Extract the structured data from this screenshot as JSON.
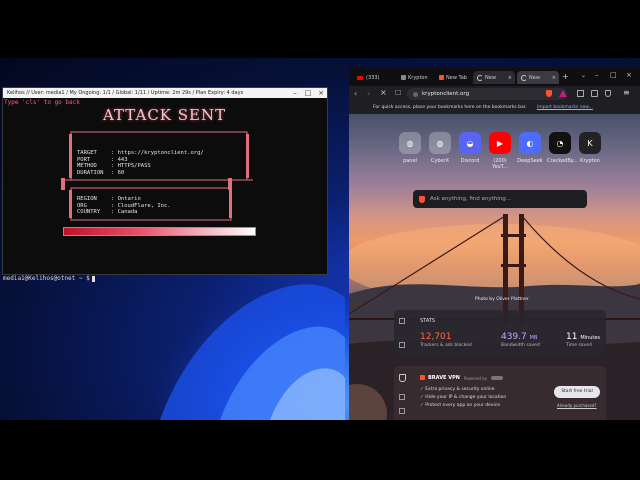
{
  "terminal": {
    "title": "Kelihos // User: media1 / My Ongoing: 1/1 / Global: 1/11 / Uptime: 2m 29s / Plan Expiry: 4 days",
    "hint": "Type 'cls' to go back",
    "banner": "ATTACK SENT",
    "fields": [
      {
        "key": "TARGET",
        "value": ": https://kryptonclient.org/"
      },
      {
        "key": "PORT",
        "value": ": 443"
      },
      {
        "key": "METHOD",
        "value": ": HTTPS/PASS"
      },
      {
        "key": "DURATION",
        "value": ": 60"
      }
    ],
    "geo": [
      {
        "key": "REGION",
        "value": ": Ontario"
      },
      {
        "key": "ORG",
        "value": ": CloudFlare, Inc."
      },
      {
        "key": "COUNTRY",
        "value": ": Canada"
      }
    ],
    "progress": 1.0,
    "prompt": "media1@Kelihos@otnet ~ $"
  },
  "browser": {
    "tabs": [
      {
        "label": "(333)",
        "icon": "youtube-icon"
      },
      {
        "label": "Krypton",
        "icon": "page-icon"
      },
      {
        "label": "New Tab",
        "icon": "brave-icon"
      },
      {
        "label": "New",
        "icon": "loading-icon"
      },
      {
        "label": "New",
        "icon": "loading-icon"
      }
    ],
    "url": "kryptonclient.org",
    "bookmarks_hint": "For quick access, place your bookmarks here on the bookmarks bar.",
    "bookmarks_link": "Import bookmarks now...",
    "shortcuts": [
      "panel",
      "CyberX",
      "Discord",
      "(200) YouT...",
      "DeepSeek",
      "CrackedBy...",
      "Krypton"
    ],
    "search_placeholder": "Ask anything, find anything...",
    "photo_credit": "Photo by Oliver Plattner",
    "stats": {
      "header": "STATS",
      "items": [
        {
          "value": "12,701",
          "label": "Trackers & ads blocked",
          "color": "#ff6a3d"
        },
        {
          "value": "439.7",
          "unit": "MB",
          "label": "Bandwidth saved",
          "color": "#c9a7ff"
        },
        {
          "value": "11",
          "unit": "Minutes",
          "label": "Time saved",
          "color": "#ffffff"
        }
      ]
    },
    "vpn": {
      "title": "BRAVE VPN",
      "powered": "Powered by",
      "bullets": [
        "Extra privacy & security online",
        "Hide your IP & change your location",
        "Protect every app on your device"
      ],
      "cta": "Start free trial",
      "link": "Already purchased?"
    }
  },
  "colors": {
    "accent": "#ff5a36",
    "terminal_frame": "#e07080",
    "banner": "#f2c6cd"
  }
}
